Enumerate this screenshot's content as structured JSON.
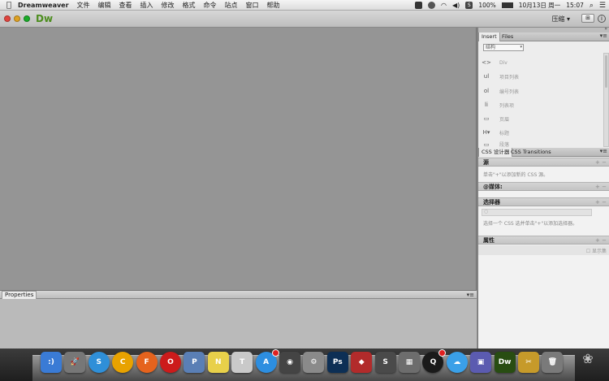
{
  "menubar": {
    "app_name": "Dreamweaver",
    "items": [
      "文件",
      "编辑",
      "查看",
      "插入",
      "修改",
      "格式",
      "命令",
      "站点",
      "窗口",
      "帮助"
    ],
    "battery": "100%",
    "date": "10月13日 周一",
    "time": "15:07"
  },
  "appbar": {
    "logo": "Dw",
    "workspace": "压缩",
    "workspace_arrow": "▾",
    "info": "i"
  },
  "properties": {
    "tab": "Properties",
    "menu": "▾≡"
  },
  "insert_panel": {
    "tabs": [
      "Insert",
      "Files"
    ],
    "menu": "▾≡",
    "category": "结构",
    "items": [
      {
        "icon": "<>",
        "label": "Div"
      },
      {
        "icon": "ul",
        "label": "项目列表"
      },
      {
        "icon": "ol",
        "label": "编号列表"
      },
      {
        "icon": "li",
        "label": "列表项"
      },
      {
        "icon": "▭",
        "label": "页眉"
      },
      {
        "icon": "H▾",
        "label": "标题"
      },
      {
        "icon": "▭",
        "label": "段落"
      }
    ]
  },
  "css_designer": {
    "tabs": [
      "CSS 设计器",
      "CSS Transitions"
    ],
    "menu": "▾≡",
    "sources_title": "源",
    "sources_controls": "+ −",
    "sources_hint": "单击\"+\"以添加新的 CSS 源。",
    "media_title": "@媒体:",
    "media_controls": "+ −",
    "selectors_title": "选择器",
    "selectors_controls": "+ −",
    "selectors_hint": "选择一个 CSS 选并单击\"+\"以添加选择器。",
    "properties_title": "属性",
    "properties_controls": "+ −",
    "show_set": "显示集"
  },
  "dock": {
    "icons": [
      {
        "name": "finder",
        "label": ":)",
        "color": "#3a7bd5"
      },
      {
        "name": "launchpad",
        "label": "🚀",
        "color": "#777777"
      },
      {
        "name": "safari",
        "label": "S",
        "color": "#2f8fd8"
      },
      {
        "name": "chrome",
        "label": "C",
        "color": "#e8a200"
      },
      {
        "name": "firefox",
        "label": "F",
        "color": "#e5631d"
      },
      {
        "name": "opera",
        "label": "O",
        "color": "#cc1b1b"
      },
      {
        "name": "preview",
        "label": "P",
        "color": "#5a7fb5"
      },
      {
        "name": "notes",
        "label": "N",
        "color": "#e8d04a"
      },
      {
        "name": "textedit",
        "label": "T",
        "color": "#c9c9c9"
      },
      {
        "name": "appstore",
        "label": "A",
        "color": "#2d8ee0"
      },
      {
        "name": "photo-booth",
        "label": "◉",
        "color": "#444444"
      },
      {
        "name": "system-preferences",
        "label": "⚙",
        "color": "#8a8a8a"
      },
      {
        "name": "photoshop",
        "label": "Ps",
        "color": "#0d2f55"
      },
      {
        "name": "photo-app",
        "label": "◆",
        "color": "#b22b2b"
      },
      {
        "name": "sublime",
        "label": "S",
        "color": "#4a4a4a"
      },
      {
        "name": "finder-window",
        "label": "▦",
        "color": "#6d6d6d"
      },
      {
        "name": "qq",
        "label": "Q",
        "color": "#1a1a1a"
      },
      {
        "name": "weather",
        "label": "☁",
        "color": "#3aa0e8"
      },
      {
        "name": "preview-2",
        "label": "▣",
        "color": "#5b5bb0"
      },
      {
        "name": "dreamweaver",
        "label": "Dw",
        "color": "#284d12"
      },
      {
        "name": "cut-tool",
        "label": "✂",
        "color": "#c69a2a"
      },
      {
        "name": "trash",
        "label": "🗑",
        "color": "#7a7a7a"
      }
    ]
  }
}
